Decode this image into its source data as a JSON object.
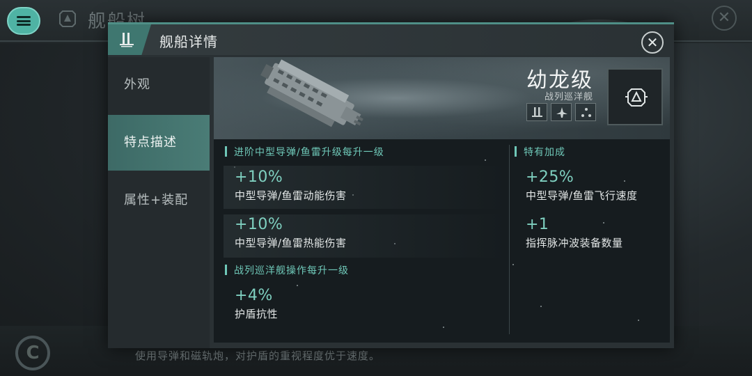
{
  "background": {
    "page_title": "舰船树",
    "description": "使用导弹和磁轨炮，对护盾的重视程度优于速度。"
  },
  "modal": {
    "title": "舰船详情",
    "tabs": [
      {
        "label": "外观",
        "active": false
      },
      {
        "label": "特点描述",
        "active": true
      },
      {
        "label": "属性+装配",
        "active": false
      }
    ]
  },
  "ship": {
    "name": "幼龙级",
    "class": "战列巡洋舰",
    "role_icons": [
      "battlecruiser-icon",
      "fighter-icon",
      "formation-icon"
    ]
  },
  "left_column": {
    "section1": {
      "title": "进阶中型导弹/鱼雷升级每升一级",
      "bonuses": [
        {
          "value": "+10%",
          "desc": "中型导弹/鱼雷动能伤害"
        },
        {
          "value": "+10%",
          "desc": "中型导弹/鱼雷热能伤害"
        }
      ]
    },
    "section2": {
      "title": "战列巡洋舰操作每升一级",
      "bonuses": [
        {
          "value": "+4%",
          "desc": "护盾抗性"
        }
      ]
    }
  },
  "right_column": {
    "title": "特有加成",
    "bonuses": [
      {
        "value": "+25%",
        "desc": "中型导弹/鱼雷飞行速度"
      },
      {
        "value": "+1",
        "desc": "指挥脉冲波装备数量"
      }
    ]
  },
  "colors": {
    "accent": "#6fc8b8",
    "active_tab": "#4a7c76",
    "value_text": "#7fd0c0"
  }
}
